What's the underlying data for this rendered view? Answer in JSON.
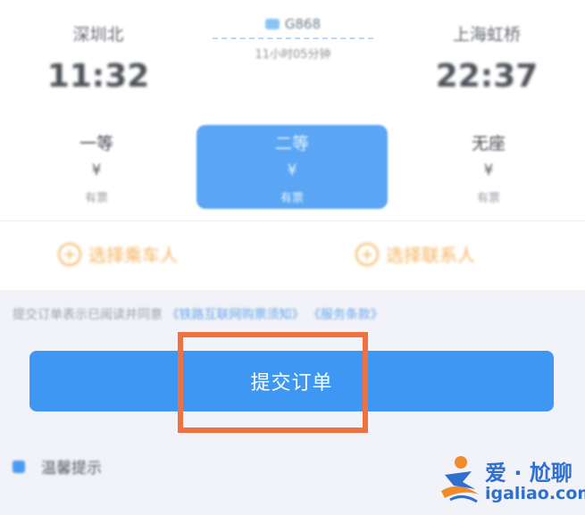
{
  "trip": {
    "from_station": "深圳北",
    "from_time": "11:32",
    "to_station": "上海虹桥",
    "to_time": "22:37",
    "train_no": "G868",
    "duration": "11小时05分钟"
  },
  "seats": [
    {
      "type": "一等",
      "price": "¥",
      "left": "有票"
    },
    {
      "type": "二等",
      "price": "¥",
      "left": "有票"
    },
    {
      "type": "无座",
      "price": "¥",
      "left": "有票"
    }
  ],
  "choosers": {
    "passenger": "选择乘车人",
    "contact": "选择联系人"
  },
  "notice": {
    "text": "提交订单表示已阅读并同意",
    "link1": "《铁路互联网购票须知》",
    "link2": "《服务条款》"
  },
  "submit": {
    "label": "提交订单"
  },
  "tip": {
    "label": "温馨提示"
  },
  "watermark": {
    "cn": "爱 · 尬聊",
    "en": "igaliao.com"
  },
  "colors": {
    "primary": "#3f97f4",
    "selected_seat": "#5aa6f5",
    "highlight_box": "#ef7041",
    "chooser_accent": "#f3b35c"
  }
}
